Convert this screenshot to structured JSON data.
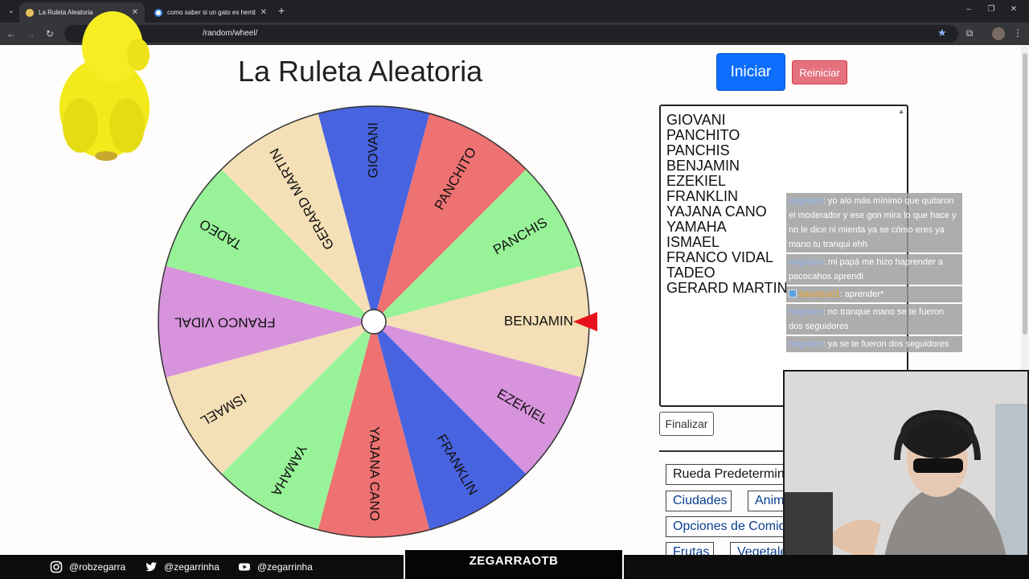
{
  "browser": {
    "tabs": [
      {
        "title": "La Ruleta Aleatoria",
        "active": true
      },
      {
        "title": "como saber si un gato es hembra",
        "active": false
      }
    ],
    "url": "/random/wheel/"
  },
  "page": {
    "title": "La Ruleta Aleatoria",
    "start_label": "Iniciar",
    "reset_label": "Reiniciar",
    "finish_label": "Finalizar",
    "names": [
      "GIOVANI",
      "PANCHITO",
      "PANCHIS",
      "BENJAMIN",
      "EZEKIEL",
      "FRANKLIN",
      "YAJANA CANO",
      "YAMAHA",
      "ISMAEL",
      "FRANCO VIDAL",
      "TADEO",
      "GERARD MARTIN"
    ],
    "presets": [
      "Rueda Predetermina",
      "Ciudades",
      "Anim",
      "Opciones de Comid",
      "Frutas",
      "Vegetale"
    ]
  },
  "wheel": {
    "segments": [
      {
        "label": "GIOVANI",
        "color": "#4863df"
      },
      {
        "label": "PANCHITO",
        "color": "#ee7272"
      },
      {
        "label": "PANCHIS",
        "color": "#98f398"
      },
      {
        "label": "BENJAMIN",
        "color": "#f4dfb6"
      },
      {
        "label": "EZEKIEL",
        "color": "#d793dc"
      },
      {
        "label": "FRANKLIN",
        "color": "#4863df"
      },
      {
        "label": "YAJANA CANO",
        "color": "#ee7272"
      },
      {
        "label": "YAMAHA",
        "color": "#98f398"
      },
      {
        "label": "ISMAEL",
        "color": "#f4dfb6"
      },
      {
        "label": "FRANCO VIDAL",
        "color": "#d793dc"
      },
      {
        "label": "TADEO",
        "color": "#98f398"
      },
      {
        "label": "GERARD MARTIN",
        "color": "#f4dfb6"
      }
    ],
    "pointer_color": "#e8121a"
  },
  "chat": [
    {
      "user": "migxelzx",
      "text": ": yo alo más mínimo que quitaron el moderador y ese gon mira lo que hace y no le dice ni mierda ya se cómo eres ya mano tu tranqui ehh"
    },
    {
      "user": "migxelzx",
      "text": ": mi papá me hizo haprender a pacocahos aprendi"
    },
    {
      "user": "bauxtzu01",
      "text": ": aprender*",
      "badge": true
    },
    {
      "user": "migxelzx",
      "text": ": no tranque mano se te fueron dos seguidores"
    },
    {
      "user": "migxelzx",
      "text": ": ya se te fueron dos seguidores"
    }
  ],
  "footer": {
    "instagram": "@robzegarra",
    "twitter": "@zegarrinha",
    "youtube": "@zegarrinha",
    "brand": "ZEGARRAOTB"
  }
}
